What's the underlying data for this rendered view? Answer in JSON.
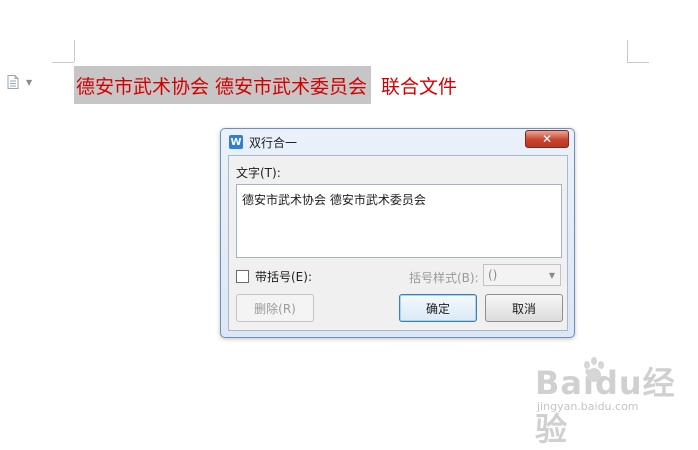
{
  "document": {
    "selected_text": "德安市武术协会  德安市武术委员会",
    "unselected_text": "联合文件",
    "text_color": "#d40000",
    "selection_color": "#c6c6c6"
  },
  "dialog": {
    "title": "双行合一",
    "close_glyph": "✕",
    "text_label": "文字(T):",
    "text_value": "德安市武术协会 德安市武术委员会",
    "bracket_checkbox_label": "带括号(E):",
    "bracket_checked": false,
    "bracket_style_label": "括号样式(B):",
    "bracket_style_value": "()",
    "delete_button": "删除(R)",
    "ok_button": "确定",
    "cancel_button": "取消"
  },
  "watermark": {
    "main": "Baidu经验",
    "sub": "jingyan.baidu.com"
  },
  "icons": {
    "doc": "document-icon",
    "app": "wps-writer-icon",
    "close": "close-icon",
    "dropdown": "chevron-down-icon",
    "paw": "baidu-paw-icon"
  }
}
